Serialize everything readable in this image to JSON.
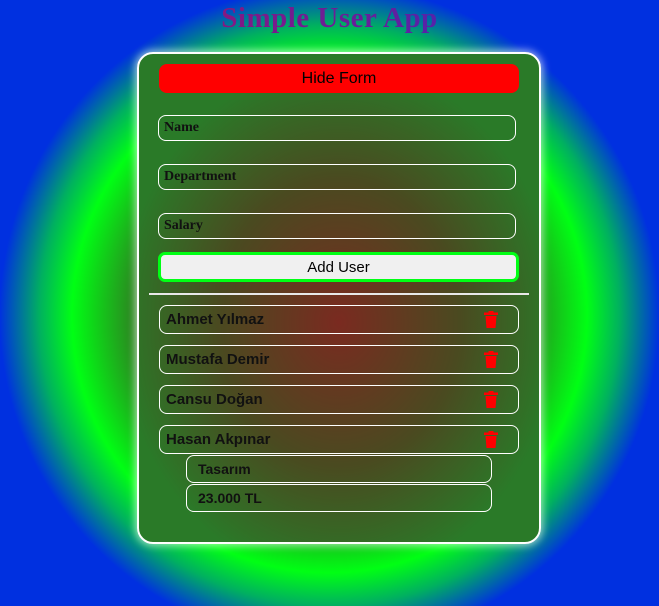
{
  "app": {
    "title": "Simple User App"
  },
  "form": {
    "toggle_label": "Hide Form",
    "name_placeholder": "Name",
    "department_placeholder": "Department",
    "salary_placeholder": "Salary",
    "submit_label": "Add User"
  },
  "users": [
    {
      "name": "Ahmet Yılmaz",
      "delete_icon": "trash-icon"
    },
    {
      "name": "Mustafa Demir",
      "delete_icon": "trash-icon"
    },
    {
      "name": "Cansu Doğan",
      "delete_icon": "trash-icon"
    },
    {
      "name": "Hasan Akpınar",
      "delete_icon": "trash-icon",
      "expanded": true,
      "department": "Tasarım",
      "salary": "23.000 TL"
    }
  ],
  "colors": {
    "danger": "#ff0000",
    "accent": "#00ff14",
    "title_start": "#b01060",
    "title_end": "#2030e0"
  }
}
